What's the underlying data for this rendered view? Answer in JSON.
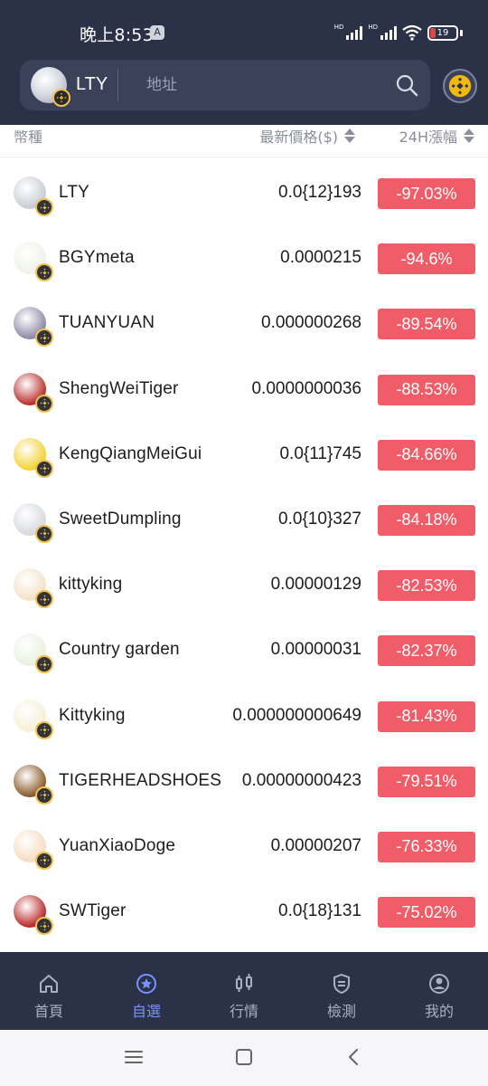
{
  "status_bar": {
    "time": "晚上8:53",
    "badge": "A",
    "hd1": "HD",
    "hd2": "HD",
    "battery": "19"
  },
  "header": {
    "chain_label": "LTY",
    "search_placeholder": "地址"
  },
  "columns": {
    "coin": "幣種",
    "price": "最新價格($)",
    "change": "24H漲幅"
  },
  "colors": {
    "accent": "#7892ff",
    "header_bg": "#2b3147",
    "negative": "#f05c68",
    "bnb_gold": "#f0b90b"
  },
  "coins": [
    {
      "name": "LTY",
      "price": "0.0{12}193",
      "change": "-97.03%",
      "avatar_color": "#c9ccd4"
    },
    {
      "name": "BGYmeta",
      "price": "0.0000215",
      "change": "-94.6%",
      "avatar_color": "#eef2e8"
    },
    {
      "name": "TUANYUAN",
      "price": "0.000000268",
      "change": "-89.54%",
      "avatar_color": "#8f8aa6"
    },
    {
      "name": "ShengWeiTiger",
      "price": "0.0000000036",
      "change": "-88.53%",
      "avatar_color": "#b8302c"
    },
    {
      "name": "KengQiangMeiGui",
      "price": "0.0{11}745",
      "change": "-84.66%",
      "avatar_color": "#f3d233"
    },
    {
      "name": "SweetDumpling",
      "price": "0.0{10}327",
      "change": "-84.18%",
      "avatar_color": "#d7d9e0"
    },
    {
      "name": "kittyking",
      "price": "0.00000129",
      "change": "-82.53%",
      "avatar_color": "#f4e2c8"
    },
    {
      "name": "Country garden",
      "price": "0.00000031",
      "change": "-82.37%",
      "avatar_color": "#e9f1de"
    },
    {
      "name": "Kittyking",
      "price": "0.000000000649",
      "change": "-81.43%",
      "avatar_color": "#f5f0d5"
    },
    {
      "name": "TIGERHEADSHOES",
      "price": "0.00000000423",
      "change": "-79.51%",
      "avatar_color": "#8a5a2a"
    },
    {
      "name": "YuanXiaoDoge",
      "price": "0.00000207",
      "change": "-76.33%",
      "avatar_color": "#f6dcc0"
    },
    {
      "name": "SWTiger",
      "price": "0.0{18}131",
      "change": "-75.02%",
      "avatar_color": "#b92a2a"
    }
  ],
  "tabs": [
    {
      "label": "首頁",
      "icon": "home-icon",
      "active": false
    },
    {
      "label": "自選",
      "icon": "star-icon",
      "active": true
    },
    {
      "label": "行情",
      "icon": "candlestick-icon",
      "active": false
    },
    {
      "label": "檢測",
      "icon": "shield-icon",
      "active": false
    },
    {
      "label": "我的",
      "icon": "user-icon",
      "active": false
    }
  ],
  "system_nav": {
    "recents": "menu-icon",
    "home": "square-icon",
    "back": "back-icon"
  }
}
